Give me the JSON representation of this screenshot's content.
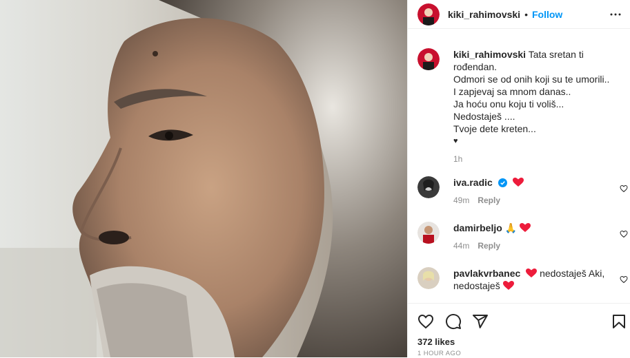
{
  "post": {
    "username": "kiki_rahimovski",
    "follow_label": "Follow",
    "dot": "•"
  },
  "caption": {
    "username": "kiki_rahimovski",
    "lines": [
      "Tata sretan ti rođendan.",
      "Odmori se od onih koji su te umorili..",
      "I zapjevaj sa mnom danas..",
      "Ja hoću onu koju ti voliš...",
      "Nedostaješ ....",
      "Tvoje dete kreten...",
      "♥"
    ],
    "time": "1h"
  },
  "comments": [
    {
      "username": "iva.radic",
      "time": "49m",
      "reply": "Reply"
    },
    {
      "username": "damirbeljo",
      "emoji": "🙏",
      "time": "44m",
      "reply": "Reply"
    },
    {
      "username": "pavlakvrbanec",
      "text": "nedostaješ Aki,",
      "text2": "nedostaješ"
    }
  ],
  "footer": {
    "likes": "372 likes",
    "time_ago": "1 HOUR AGO"
  },
  "colors": {
    "accent": "#0095f6",
    "heart": "#ed1c3b"
  }
}
